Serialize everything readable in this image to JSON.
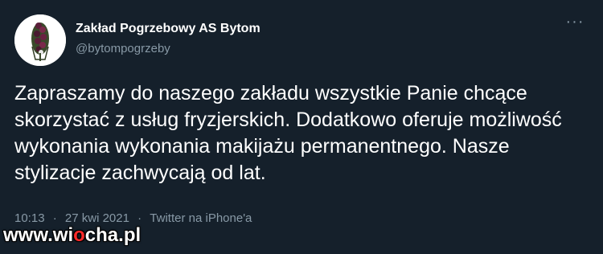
{
  "tweet": {
    "author_name": "Zakład Pogrzebowy AS Bytom",
    "author_handle": "@bytompogrzeby",
    "more_icon": "more-horizontal-icon",
    "more_symbol": "···",
    "text": "Zapraszamy do naszego zakładu wszystkie Panie chcące skorzystać z usług fryzjerskich. Dodatkowo oferuje możliwość wykonania wykonania makijażu permanentnego. Nasze stylizacje zachwycają od lat.",
    "time": "10:13",
    "date": "27 kwi 2021",
    "separator": "·",
    "source": "Twitter na iPhone'a"
  },
  "watermark": {
    "prefix": "www.wi",
    "accent": "o",
    "suffix": "cha.pl"
  },
  "colors": {
    "background": "#15202b",
    "text": "#ffffff",
    "secondary": "#8899a6",
    "watermark_accent": "#ff2a2a"
  }
}
